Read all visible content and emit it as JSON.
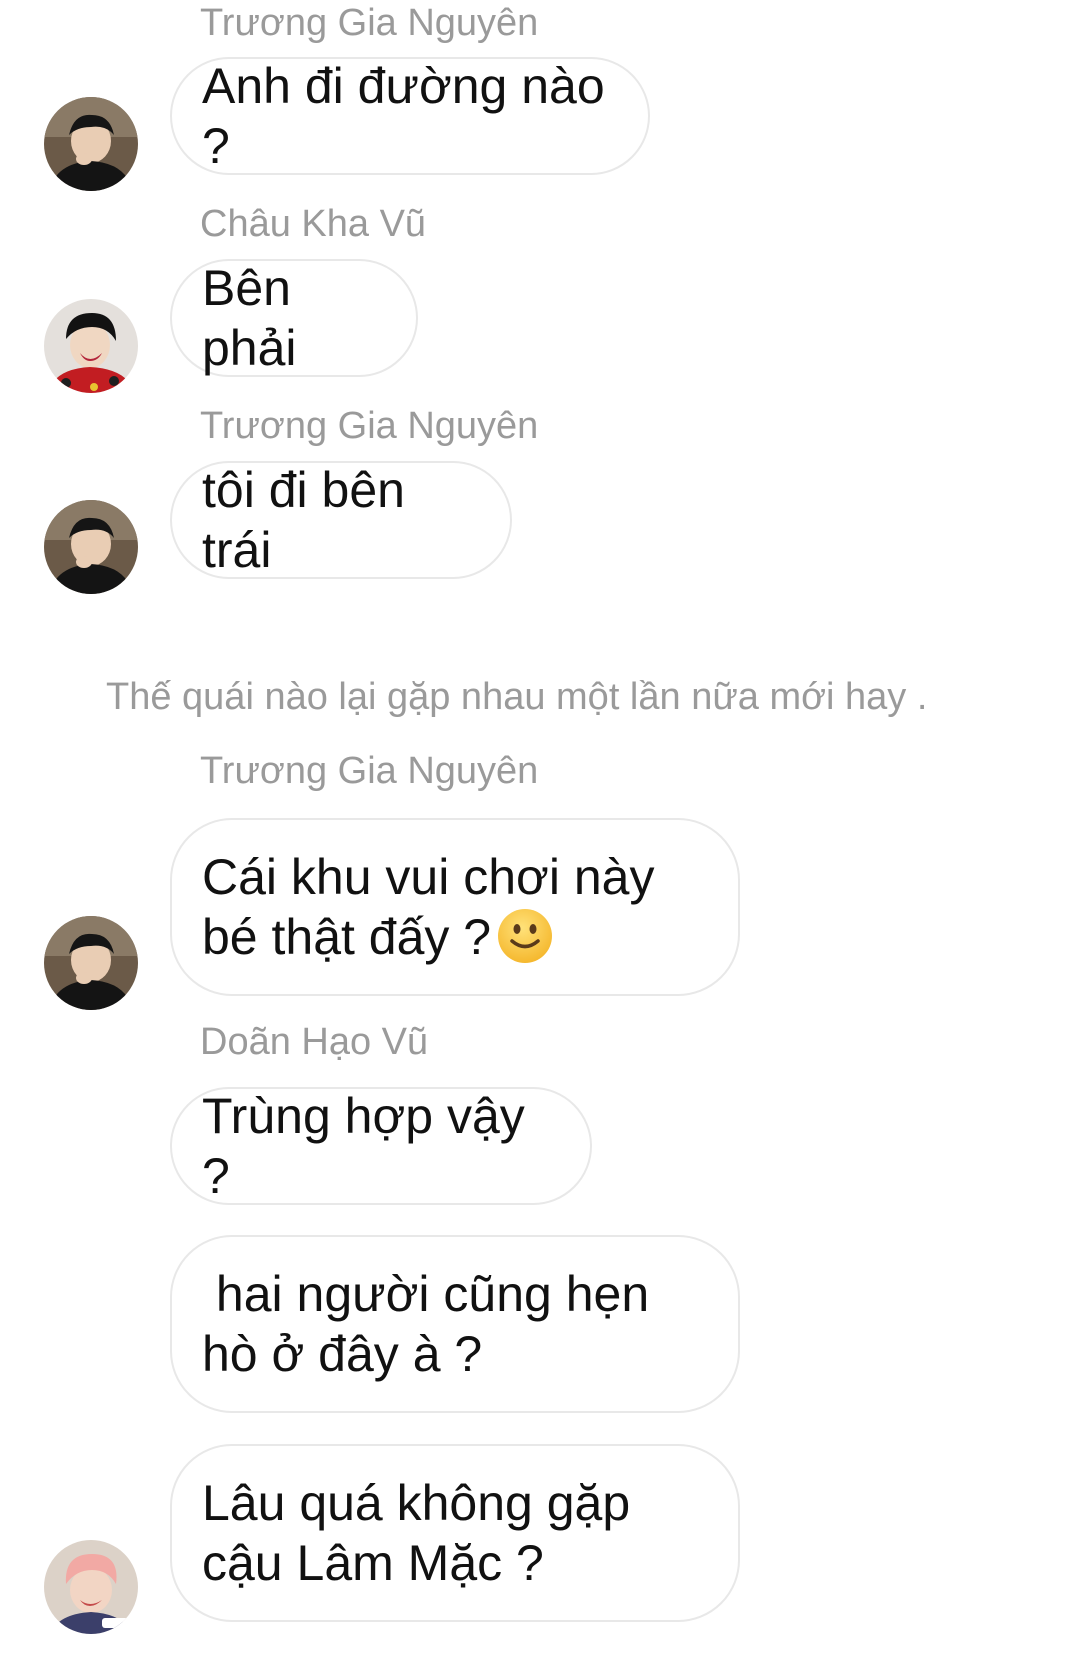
{
  "messages": [
    {
      "sender": "Trương Gia Nguyên",
      "text": "Anh đi đường nào ?"
    },
    {
      "sender": "Châu Kha Vũ",
      "text": "Bên phải"
    },
    {
      "sender": "Trương Gia Nguyên",
      "text": "tôi đi bên trái"
    },
    {
      "sender": "Trương Gia Nguyên",
      "text": "Cái khu vui chơi này\nbé thật đấy ?"
    },
    {
      "sender": "Doãn Hạo Vũ",
      "text": "Trùng hợp vậy ?"
    },
    {
      "text": " hai người cũng hẹn\nhò ở đây à ?"
    },
    {
      "text": "Lâu quá không gặp\ncậu Lâm Mặc ?"
    }
  ],
  "narration": "Thế quái nào lại gặp nhau một lần nữa mới hay .",
  "icons": {
    "emoji": "slightly-smiling-face-icon"
  },
  "colors": {
    "background": "#ffffff",
    "bubble_border": "#e8e8e8",
    "name_text": "#9a9a9a",
    "message_text": "#111111"
  }
}
